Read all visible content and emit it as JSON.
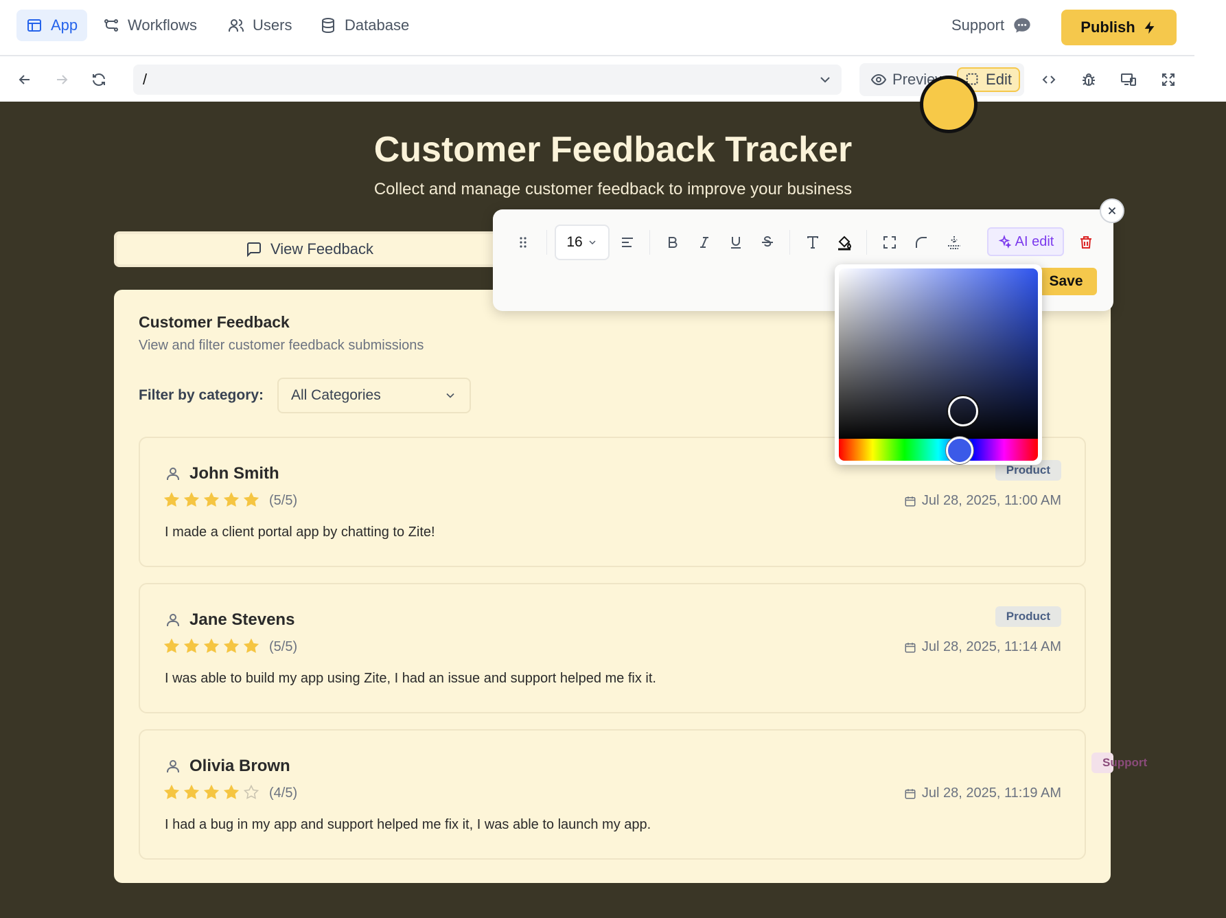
{
  "nav": {
    "tabs": [
      {
        "label": "App",
        "icon": "app-window-icon",
        "active": true
      },
      {
        "label": "Workflows",
        "icon": "workflow-icon"
      },
      {
        "label": "Users",
        "icon": "users-icon"
      },
      {
        "label": "Database",
        "icon": "database-icon"
      }
    ],
    "support_label": "Support",
    "publish_label": "Publish"
  },
  "toolbar": {
    "url": "/",
    "preview_label": "Preview",
    "edit_label": "Edit"
  },
  "page": {
    "title": "Customer Feedback Tracker",
    "subtitle": "Collect and manage customer feedback to improve your business",
    "view_feedback_label": "View Feedback"
  },
  "card": {
    "title": "Customer Feedback",
    "description": "View and filter customer feedback submissions",
    "filter_label": "Filter by category:",
    "filter_value": "All Categories"
  },
  "feedback": [
    {
      "name": "John Smith",
      "rating": 5,
      "score": "(5/5)",
      "category": "Product",
      "date": "Jul 28, 2025, 11:00 AM",
      "message": "I made a client portal app by chatting to Zite!"
    },
    {
      "name": "Jane Stevens",
      "rating": 5,
      "score": "(5/5)",
      "category": "Product",
      "date": "Jul 28, 2025, 11:14 AM",
      "message": "I was able to build my app using Zite, I had an issue and support helped me fix it."
    },
    {
      "name": "Olivia Brown",
      "rating": 4,
      "score": "(4/5)",
      "category": "Support",
      "date": "Jul 28, 2025, 11:19 AM",
      "message": "I had a bug in my app and support helped me fix it, I was able to launch my app."
    }
  ],
  "format_bar": {
    "font_size": "16",
    "ai_edit_label": "AI edit",
    "save_label": "Save"
  },
  "color_picker": {
    "selected_hue_color": "#3b5ae8"
  },
  "colors": {
    "accent": "#f5c84c",
    "canvas_bg": "#3a3626",
    "card_bg": "#fdf5d8",
    "star": "#f5c542",
    "active_tab": "#2563eb"
  }
}
